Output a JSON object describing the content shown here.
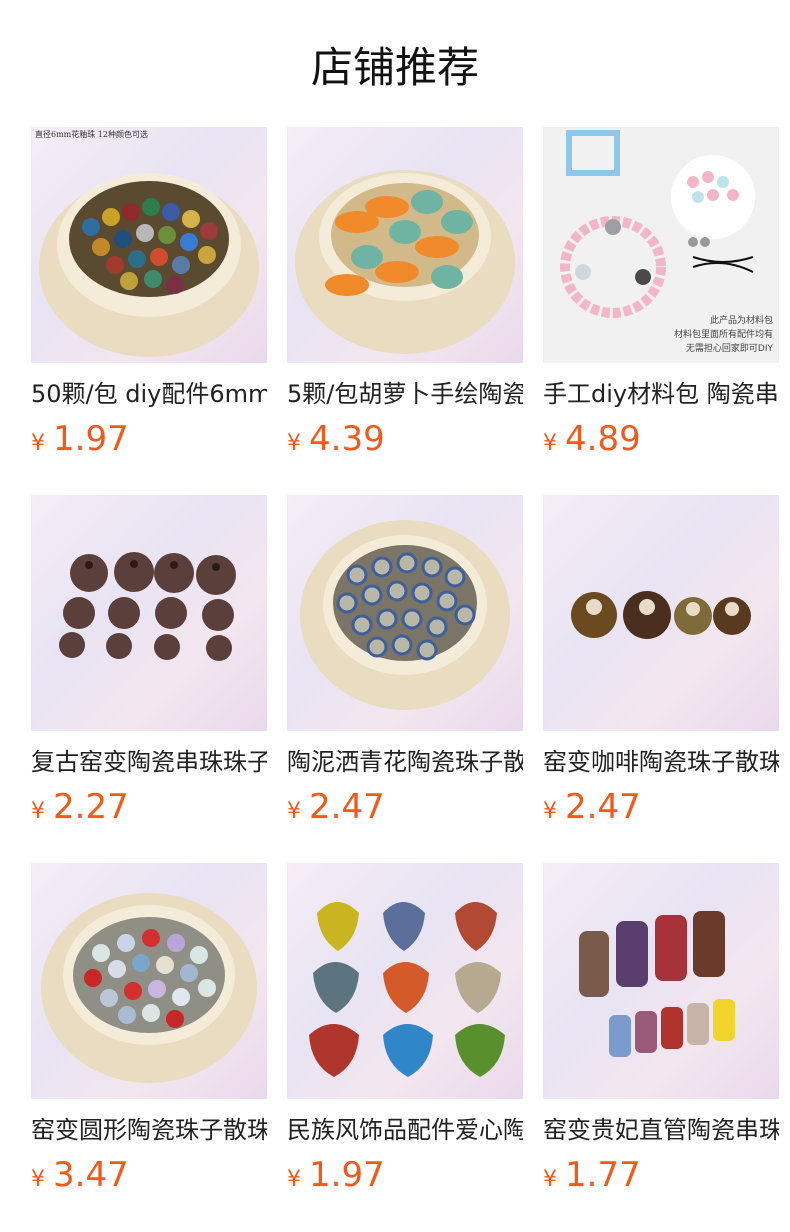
{
  "header": {
    "title": "店铺推荐"
  },
  "products": [
    {
      "title": "50颗/包 diy配件6mm",
      "currency": "¥",
      "price": "1.97",
      "image_caption": "直径6mm花釉珠 12种颜色可选"
    },
    {
      "title": "5颗/包胡萝卜手绘陶瓷",
      "currency": "¥",
      "price": "4.39"
    },
    {
      "title": "手工diy材料包 陶瓷串",
      "currency": "¥",
      "price": "4.89",
      "image_notes": [
        "此产品为材料包",
        "材料包里面所有配件均有",
        "无需担心回家即可DIY"
      ]
    },
    {
      "title": "复古窑变陶瓷串珠珠子",
      "currency": "¥",
      "price": "2.27"
    },
    {
      "title": "陶泥洒青花陶瓷珠子散",
      "currency": "¥",
      "price": "2.47"
    },
    {
      "title": "窑变咖啡陶瓷珠子散珠",
      "currency": "¥",
      "price": "2.47"
    },
    {
      "title": "窑变圆形陶瓷珠子散珠",
      "currency": "¥",
      "price": "3.47"
    },
    {
      "title": "民族风饰品配件爱心陶",
      "currency": "¥",
      "price": "1.97"
    },
    {
      "title": "窑变贵妃直管陶瓷串珠",
      "currency": "¥",
      "price": "1.77"
    }
  ],
  "colors": {
    "price": "#f05a1a",
    "background": "#ffffff"
  }
}
